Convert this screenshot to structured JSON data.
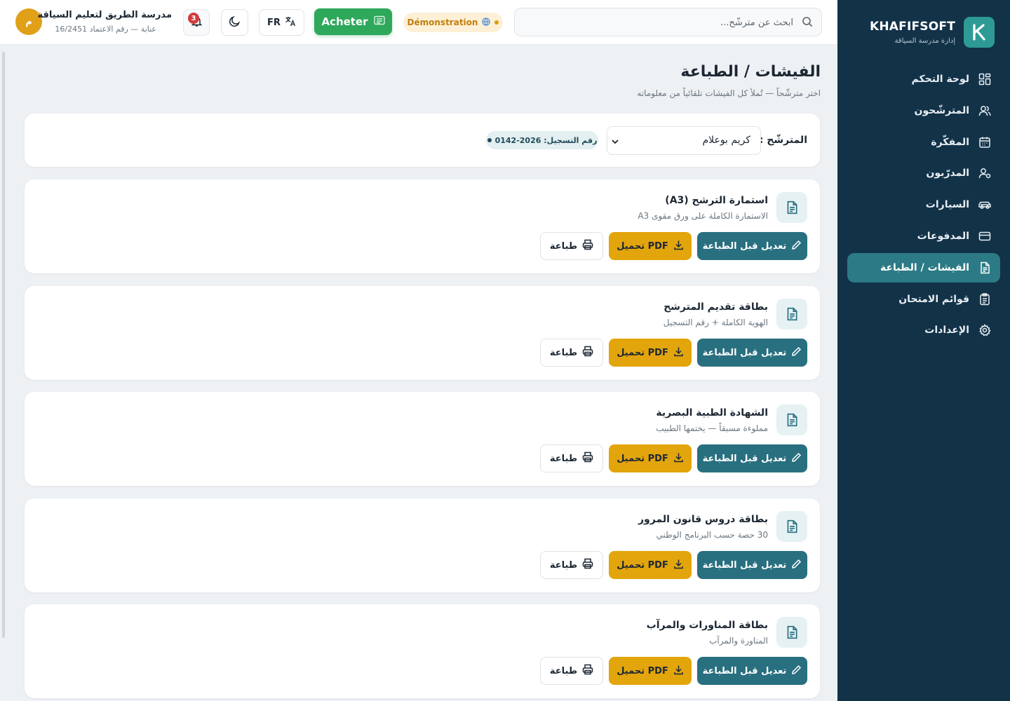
{
  "sidebar": {
    "brand_name": "KHAFIFSOFT",
    "brand_sub": "إدارة مدرسة السياقة",
    "items": [
      {
        "label": "لوحة التحكم",
        "icon": "dashboard-icon"
      },
      {
        "label": "المترشّحون",
        "icon": "users-icon"
      },
      {
        "label": "المفكّرة",
        "icon": "calendar-icon"
      },
      {
        "label": "المدرّبون",
        "icon": "instructor-icon"
      },
      {
        "label": "السيارات",
        "icon": "car-icon"
      },
      {
        "label": "المدفوعات",
        "icon": "credit-card-icon"
      },
      {
        "label": "الفيشات / الطباعة",
        "icon": "document-icon",
        "active": true
      },
      {
        "label": "قوائم الامتحان",
        "icon": "clipboard-icon"
      },
      {
        "label": "الإعدادات",
        "icon": "gear-icon"
      }
    ]
  },
  "topbar": {
    "search_placeholder": "ابحث عن مترشّح...",
    "demo_label": "Démonstration",
    "buy_label": "Acheter",
    "lang_label": "FR",
    "notifications_count": "3",
    "school_name": "مدرسة الطريق لتعليم السياقة",
    "school_sub": "عنابة — رقم الاعتماد 16/2451",
    "avatar_letter": "م"
  },
  "page": {
    "title": "الفيشات / الطباعة",
    "subtitle": "اختر مترشّحاً — تُملأ كل الفيشات تلقائياً من معلوماته"
  },
  "candidate": {
    "label": "المترشّح :",
    "selected": "كريم بوعلام",
    "registration": "رقم التسجيل: 2026-0142"
  },
  "actions": {
    "edit_label": "تعديل قبل الطباعة",
    "pdf_label": "تحميل PDF",
    "print_label": "طباعة"
  },
  "forms": [
    {
      "title": "استمارة الترشح (A3)",
      "subtitle": "الاستمارة الكاملة على ورق مقوى A3"
    },
    {
      "title": "بطاقة تقديم المترشح",
      "subtitle": "الهوية الكاملة + رقم التسجيل"
    },
    {
      "title": "الشهادة الطبية البصرية",
      "subtitle": "مملوءة مسبقاً — يختمها الطبيب"
    },
    {
      "title": "بطاقة دروس قانون المرور",
      "subtitle": "30 حصة حسب البرنامج الوطني"
    },
    {
      "title": "بطاقة المناورات والمرآب",
      "subtitle": "المناورة والمرآب"
    }
  ],
  "colors": {
    "sidebar_bg": "#123248",
    "accent_teal": "#286f80",
    "accent_gold": "#e3a50c",
    "buy_green": "#2ea85b"
  }
}
